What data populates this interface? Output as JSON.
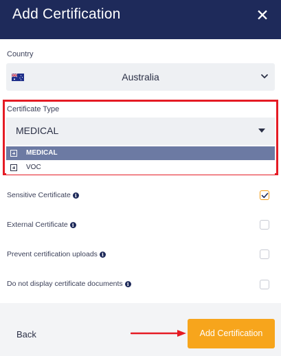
{
  "header": {
    "title": "Add Certification",
    "close_icon": "close-icon"
  },
  "country": {
    "label": "Country",
    "value": "Australia",
    "flag_icon": "australia-flag-icon"
  },
  "certificate_type": {
    "label": "Certificate Type",
    "value": "MEDICAL",
    "options": [
      {
        "label": "MEDICAL",
        "selected": true
      },
      {
        "label": "VOC",
        "selected": false
      }
    ]
  },
  "options": [
    {
      "label": "Sensitive Certificate",
      "checked": true
    },
    {
      "label": "External Certificate",
      "checked": false
    },
    {
      "label": "Prevent certification uploads",
      "checked": false
    },
    {
      "label": "Do not display certificate documents",
      "checked": false
    }
  ],
  "footer": {
    "back_label": "Back",
    "add_label": "Add Certification"
  },
  "colors": {
    "header": "#1e2a5a",
    "accent": "#f7a51c",
    "highlight": "#e51b24",
    "selected_option": "#6c7aa3"
  }
}
